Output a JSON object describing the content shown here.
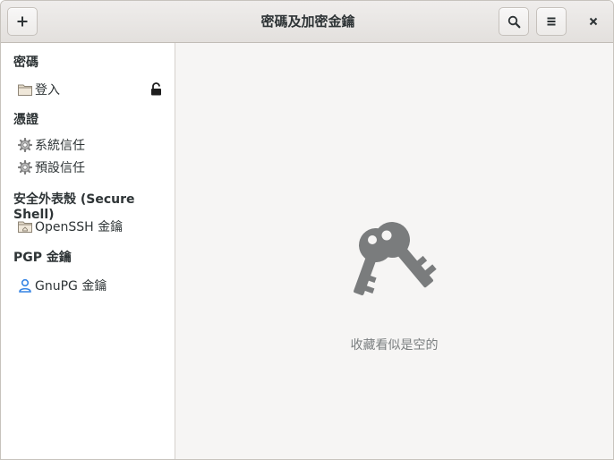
{
  "window": {
    "title": "密碼及加密金鑰"
  },
  "headerbar": {
    "add_icon": "plus-icon",
    "search_icon": "search-icon",
    "menu_icon": "hamburger-menu-icon",
    "close_icon": "close-icon"
  },
  "sidebar": {
    "sections": [
      {
        "label": "密碼",
        "items": [
          {
            "label": "登入",
            "icon": "folder-icon",
            "locked": true
          }
        ]
      },
      {
        "label": "憑證",
        "items": [
          {
            "label": "系統信任",
            "icon": "gear-icon"
          },
          {
            "label": "預設信任",
            "icon": "gear-icon"
          }
        ]
      },
      {
        "label": "安全外表殼 (Secure Shell)",
        "items": [
          {
            "label": "OpenSSH 金鑰",
            "icon": "home-folder-icon"
          }
        ]
      },
      {
        "label": "PGP 金鑰",
        "items": [
          {
            "label": "GnuPG 金鑰",
            "icon": "user-icon"
          }
        ]
      }
    ]
  },
  "main": {
    "empty_icon": "keys-icon",
    "empty_message": "收藏看似是空的"
  },
  "colors": {
    "headerbar": "#e8e6e3",
    "sidebar": "#ffffff",
    "content": "#f6f5f4",
    "empty_icon": "#7a7c7d",
    "empty_text": "#7b7f80"
  }
}
